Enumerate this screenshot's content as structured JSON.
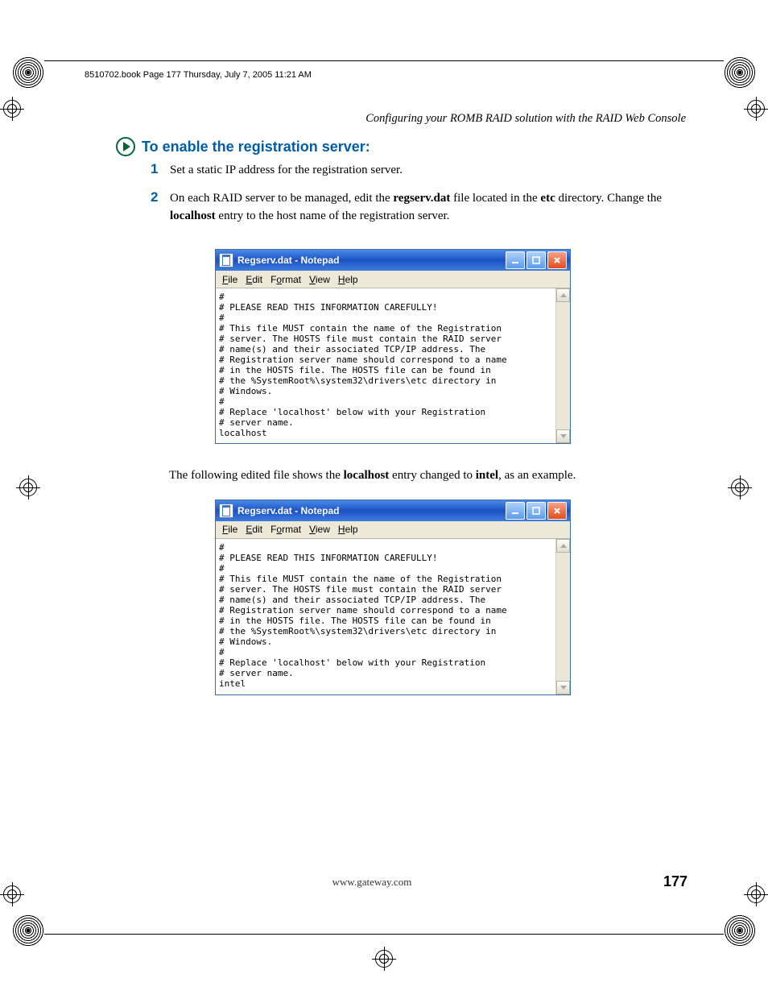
{
  "book_header": "8510702.book  Page 177  Thursday, July 7, 2005  11:21 AM",
  "running_header": "Configuring your ROMB RAID solution with the RAID Web Console",
  "heading": "To enable the registration server:",
  "steps": [
    {
      "num": "1",
      "text": "Set a static IP address for the registration server."
    },
    {
      "num": "2",
      "text_parts": [
        "On each RAID server to be managed, edit the ",
        "regserv.dat",
        " file located in the ",
        "etc",
        " directory. Change the ",
        "localhost",
        " entry to the host name of the registration server."
      ]
    }
  ],
  "notepad1": {
    "title": "Regserv.dat - Notepad",
    "menu": [
      "File",
      "Edit",
      "Format",
      "View",
      "Help"
    ],
    "content": "#\n# PLEASE READ THIS INFORMATION CAREFULLY!\n#\n# This file MUST contain the name of the Registration\n# server. The HOSTS file must contain the RAID server\n# name(s) and their associated TCP/IP address. The\n# Registration server name should correspond to a name\n# in the HOSTS file. The HOSTS file can be found in\n# the %SystemRoot%\\system32\\drivers\\etc directory in\n# Windows.\n#\n# Replace 'localhost' below with your Registration\n# server name.\nlocalhost"
  },
  "mid_para_parts": [
    "The following edited file shows the ",
    "localhost",
    " entry changed to ",
    "intel",
    ", as an example."
  ],
  "notepad2": {
    "title": "Regserv.dat - Notepad",
    "menu": [
      "File",
      "Edit",
      "Format",
      "View",
      "Help"
    ],
    "content": "#\n# PLEASE READ THIS INFORMATION CAREFULLY!\n#\n# This file MUST contain the name of the Registration\n# server. The HOSTS file must contain the RAID server\n# name(s) and their associated TCP/IP address. The\n# Registration server name should correspond to a name\n# in the HOSTS file. The HOSTS file can be found in\n# the %SystemRoot%\\system32\\drivers\\etc directory in\n# Windows.\n#\n# Replace 'localhost' below with your Registration\n# server name.\nintel"
  },
  "footer": {
    "url": "www.gateway.com",
    "page": "177"
  }
}
